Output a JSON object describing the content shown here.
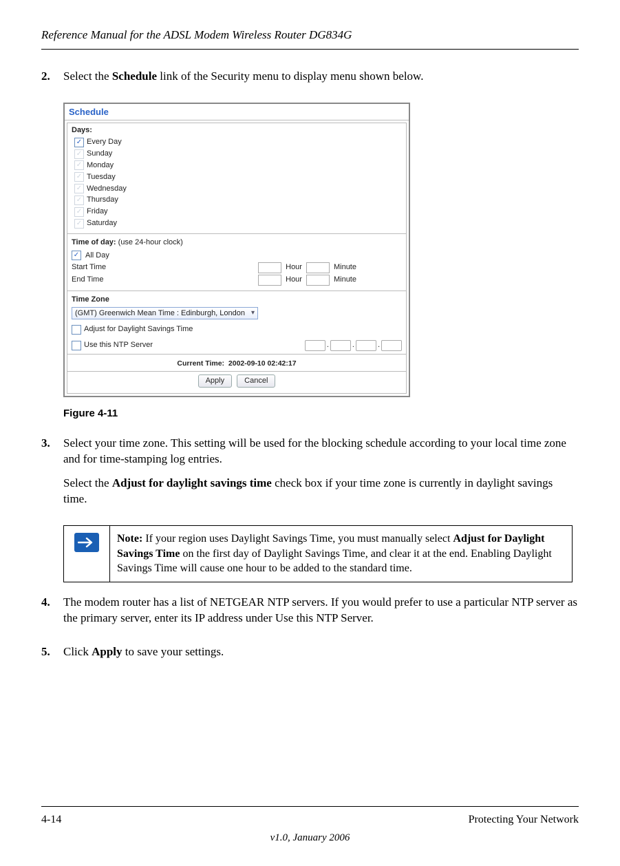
{
  "header": {
    "title": "Reference Manual for the ADSL Modem Wireless Router DG834G"
  },
  "steps": {
    "s2": {
      "num": "2.",
      "text_pre": "Select the ",
      "bold": "Schedule",
      "text_post": " link of the Security menu to display menu shown below."
    },
    "s3": {
      "num": "3.",
      "p1": "Select your time zone. This setting will be used for the blocking schedule according to your local time zone and for time-stamping log entries.",
      "p2_pre": "Select the ",
      "p2_bold": "Adjust for daylight savings time",
      "p2_post": " check box if your time zone is currently in daylight savings time."
    },
    "s4": {
      "num": "4.",
      "text": "The modem router has a list of NETGEAR NTP servers. If you would prefer to use a particular NTP server as the primary server, enter its IP address under Use this NTP Server."
    },
    "s5": {
      "num": "5.",
      "pre": "Click ",
      "bold": "Apply",
      "post": " to save your settings."
    }
  },
  "figure": {
    "caption": "Figure 4-11"
  },
  "note": {
    "label": "Note:",
    "pre": " If your region uses Daylight Savings Time, you must manually select ",
    "bold": "Adjust for Daylight Savings Time",
    "post": " on the first day of Daylight Savings Time, and clear it at the end. Enabling Daylight Savings Time will cause one hour to be added to the standard time."
  },
  "screenshot": {
    "title": "Schedule",
    "days_label": "Days:",
    "days": [
      "Every Day",
      "Sunday",
      "Monday",
      "Tuesday",
      "Wednesday",
      "Thursday",
      "Friday",
      "Saturday"
    ],
    "days_checked": [
      true,
      true,
      true,
      true,
      true,
      true,
      true,
      true
    ],
    "tod_label": "Time of day:",
    "tod_sub": " (use 24-hour clock)",
    "all_day": "All Day",
    "start": "Start Time",
    "end": "End Time",
    "hour": "Hour",
    "minute": "Minute",
    "tz_label": "Time Zone",
    "tz_value": "(GMT) Greenwich Mean Time : Edinburgh, London",
    "adjust": "Adjust for Daylight Savings Time",
    "ntp": "Use this NTP Server",
    "current_time_label": "Current Time:",
    "current_time_value": "2002-09-10 02:42:17",
    "apply": "Apply",
    "cancel": "Cancel"
  },
  "footer": {
    "left": "4-14",
    "right": "Protecting Your Network",
    "center": "v1.0, January 2006"
  }
}
